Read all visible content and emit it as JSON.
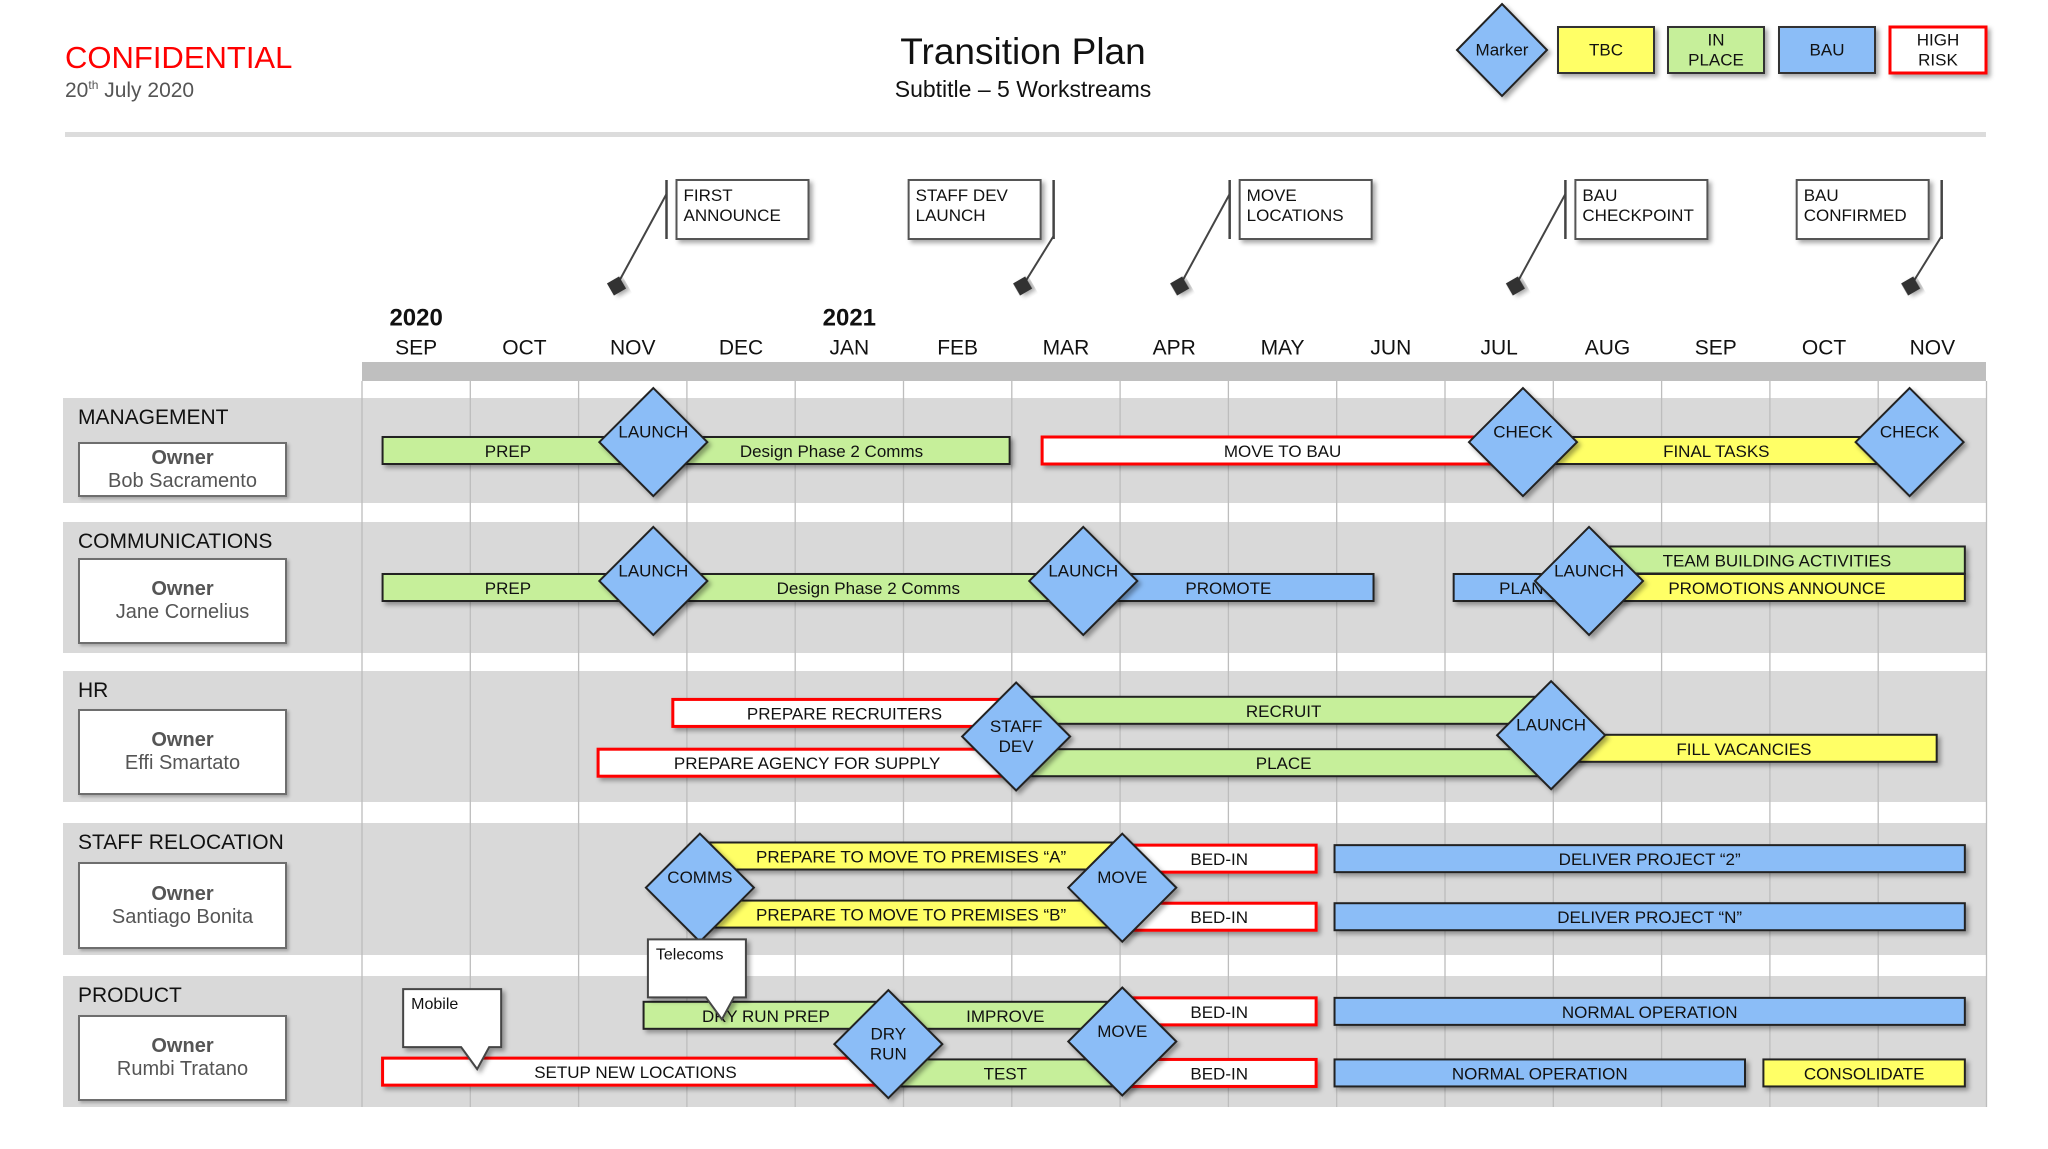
{
  "header": {
    "confidential": "CONFIDENTIAL",
    "date_day": "20",
    "date_suffix": "th",
    "date_rest": " July 2020",
    "title": "Transition Plan",
    "subtitle": "Subtitle – 5 Workstreams"
  },
  "legend": [
    {
      "shape": "diamond",
      "label": "Marker",
      "fill": "#8bbdf7",
      "border": "#222222"
    },
    {
      "shape": "box",
      "label": "TBC",
      "fill": "#ffff66",
      "border": "#333333"
    },
    {
      "shape": "box",
      "label": "IN\nPLACE",
      "fill": "#c6ef9a",
      "border": "#333333"
    },
    {
      "shape": "box",
      "label": "BAU",
      "fill": "#8bbdf7",
      "border": "#333333"
    },
    {
      "shape": "box",
      "label": "HIGH\nRISK",
      "fill": "#ffffff",
      "border": "#ff0000"
    }
  ],
  "colors": {
    "tbc": "#ffff66",
    "in_place": "#c6ef9a",
    "bau": "#8bbdf7",
    "high_risk_fill": "#ffffff",
    "high_risk_border": "#ff0000",
    "marker": "#8bbdf7",
    "band": "#d9d9d9",
    "header_bar": "#bfbfbf"
  },
  "timeline": {
    "years": [
      {
        "label": "2020",
        "month_index": 0
      },
      {
        "label": "2021",
        "month_index": 4
      }
    ],
    "months": [
      "SEP",
      "OCT",
      "NOV",
      "DEC",
      "JAN",
      "FEB",
      "MAR",
      "APR",
      "MAY",
      "JUN",
      "JUL",
      "AUG",
      "SEP",
      "OCT",
      "NOV"
    ]
  },
  "milestones": [
    {
      "label": "FIRST\nANNOUNCE",
      "month": 2.35,
      "side": "left"
    },
    {
      "label": "STAFF DEV\nLAUNCH",
      "month": 6.1,
      "side": "right"
    },
    {
      "label": "MOVE\nLOCATIONS",
      "month": 7.55,
      "side": "left"
    },
    {
      "label": "BAU\nCHECKPOINT",
      "month": 10.65,
      "side": "left"
    },
    {
      "label": "BAU\nCONFIRMED",
      "month": 14.3,
      "side": "right"
    }
  ],
  "workstreams": [
    {
      "name": "MANAGEMENT",
      "owner_label": "Owner",
      "owner": "Bob Sacramento",
      "bars": [
        {
          "label": "PREP",
          "status": "in_place",
          "start": 0.19,
          "end": 2.69,
          "lane": 0.5
        },
        {
          "label": "Design Phase 2 Comms",
          "status": "in_place",
          "start": 2.69,
          "end": 5.98,
          "lane": 0.5
        },
        {
          "label": "MOVE TO BAU",
          "status": "high_risk",
          "start": 6.28,
          "end": 10.72,
          "lane": 0.5
        },
        {
          "label": "FINAL TASKS",
          "status": "tbc",
          "start": 10.72,
          "end": 14.29,
          "lane": 0.5
        }
      ],
      "markers": [
        {
          "label": "LAUNCH",
          "month": 2.69,
          "lane": 0.42
        },
        {
          "label": "CHECK",
          "month": 10.72,
          "lane": 0.42
        },
        {
          "label": "CHECK",
          "month": 14.29,
          "lane": 0.42
        }
      ]
    },
    {
      "name": "COMMUNICATIONS",
      "owner_label": "Owner",
      "owner": "Jane Cornelius",
      "bars": [
        {
          "label": "PREP",
          "status": "in_place",
          "start": 0.19,
          "end": 2.69,
          "lane": 0.5
        },
        {
          "label": "Design Phase 2 Comms",
          "status": "in_place",
          "start": 2.69,
          "end": 6.66,
          "lane": 0.5
        },
        {
          "label": "PROMOTE",
          "status": "bau",
          "start": 6.66,
          "end": 9.34,
          "lane": 0.5
        },
        {
          "label": "PLAN",
          "status": "bau",
          "start": 10.08,
          "end": 11.33,
          "lane": 0.5
        },
        {
          "label": "TEAM BUILDING ACTIVITIES",
          "status": "in_place",
          "start": 11.33,
          "end": 14.8,
          "lane": 0.29
        },
        {
          "label": "PROMOTIONS ANNOUNCE",
          "status": "tbc",
          "start": 11.33,
          "end": 14.8,
          "lane": 0.5
        }
      ],
      "markers": [
        {
          "label": "LAUNCH",
          "month": 2.69,
          "lane": 0.45
        },
        {
          "label": "LAUNCH",
          "month": 6.66,
          "lane": 0.45
        },
        {
          "label": "LAUNCH",
          "month": 11.33,
          "lane": 0.45
        }
      ]
    },
    {
      "name": "HR",
      "owner_label": "Owner",
      "owner": "Effi Smartato",
      "bars": [
        {
          "label": "PREPARE RECRUITERS",
          "status": "high_risk",
          "start": 2.87,
          "end": 6.04,
          "lane": 0.32
        },
        {
          "label": "PREPARE AGENCY FOR SUPPLY",
          "status": "high_risk",
          "start": 2.18,
          "end": 6.04,
          "lane": 0.7
        },
        {
          "label": "RECRUIT",
          "status": "in_place",
          "start": 6.04,
          "end": 10.98,
          "lane": 0.3
        },
        {
          "label": "PLACE",
          "status": "in_place",
          "start": 6.04,
          "end": 10.98,
          "lane": 0.7
        },
        {
          "label": "FILL VACANCIES",
          "status": "tbc",
          "start": 10.98,
          "end": 14.54,
          "lane": 0.59
        }
      ],
      "markers": [
        {
          "label": "STAFF\nDEV",
          "month": 6.04,
          "lane": 0.5
        },
        {
          "label": "LAUNCH",
          "month": 10.98,
          "lane": 0.49
        }
      ]
    },
    {
      "name": "STAFF RELOCATION",
      "owner_label": "Owner",
      "owner": "Santiago Bonita",
      "bars": [
        {
          "label": "PREPARE TO MOVE TO PREMISES “A”",
          "status": "tbc",
          "start": 3.12,
          "end": 7.02,
          "lane": 0.25
        },
        {
          "label": "PREPARE TO MOVE TO PREMISES “B”",
          "status": "tbc",
          "start": 3.12,
          "end": 7.02,
          "lane": 0.69
        },
        {
          "label": "BED-IN",
          "status": "high_risk",
          "start": 7.02,
          "end": 8.81,
          "lane": 0.27
        },
        {
          "label": "BED-IN",
          "status": "high_risk",
          "start": 7.02,
          "end": 8.81,
          "lane": 0.71
        },
        {
          "label": "DELIVER PROJECT “2”",
          "status": "bau",
          "start": 8.98,
          "end": 14.8,
          "lane": 0.27
        },
        {
          "label": "DELIVER PROJECT “N”",
          "status": "bau",
          "start": 8.98,
          "end": 14.8,
          "lane": 0.71
        }
      ],
      "markers": [
        {
          "label": "COMMS",
          "month": 3.12,
          "lane": 0.49
        },
        {
          "label": "MOVE",
          "month": 7.02,
          "lane": 0.49
        }
      ]
    },
    {
      "name": "PRODUCT",
      "owner_label": "Owner",
      "owner": "Rumbi Tratano",
      "bars": [
        {
          "label": "DRY RUN PREP",
          "status": "in_place",
          "start": 2.6,
          "end": 4.86,
          "lane": 0.3
        },
        {
          "label": "IMPROVE",
          "status": "in_place",
          "start": 4.86,
          "end": 7.02,
          "lane": 0.3
        },
        {
          "label": "SETUP NEW LOCATIONS",
          "status": "high_risk",
          "start": 0.19,
          "end": 4.86,
          "lane": 0.73
        },
        {
          "label": "TEST",
          "status": "in_place",
          "start": 4.86,
          "end": 7.02,
          "lane": 0.74
        },
        {
          "label": "BED-IN",
          "status": "high_risk",
          "start": 7.02,
          "end": 8.81,
          "lane": 0.27
        },
        {
          "label": "BED-IN",
          "status": "high_risk",
          "start": 7.02,
          "end": 8.81,
          "lane": 0.74
        },
        {
          "label": "NORMAL OPERATION",
          "status": "bau",
          "start": 8.98,
          "end": 14.8,
          "lane": 0.27
        },
        {
          "label": "NORMAL OPERATION",
          "status": "bau",
          "start": 8.98,
          "end": 12.77,
          "lane": 0.74
        },
        {
          "label": "CONSOLIDATE",
          "status": "tbc",
          "start": 12.94,
          "end": 14.8,
          "lane": 0.74
        }
      ],
      "markers": [
        {
          "label": "DRY\nRUN",
          "month": 4.86,
          "lane": 0.52
        },
        {
          "label": "MOVE",
          "month": 7.02,
          "lane": 0.5
        }
      ],
      "notes": [
        {
          "label": "Telecoms",
          "month": 2.64,
          "lane": -0.28
        },
        {
          "label": "Mobile",
          "month": 0.38,
          "lane": 0.1
        }
      ]
    }
  ]
}
